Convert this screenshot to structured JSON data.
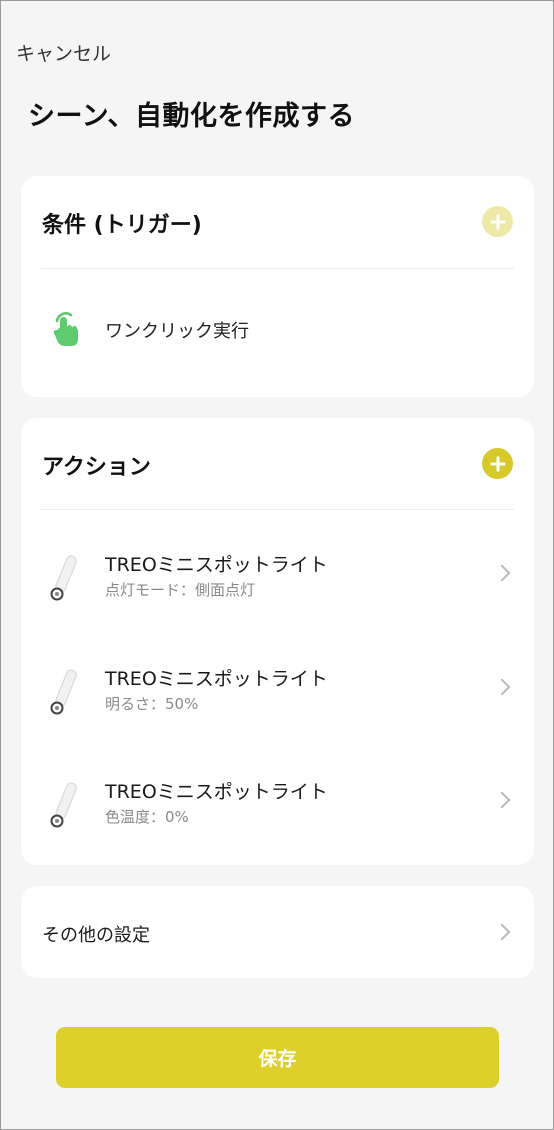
{
  "header": {
    "cancel_label": "キャンセル",
    "title": "シーン、自動化を作成する"
  },
  "condition": {
    "title": "条件 (トリガー)",
    "add_icon": "plus-icon",
    "add_color": "#efe9a8",
    "items": [
      {
        "icon": "tap-hand-icon",
        "label": "ワンクリック実行",
        "icon_color": "#5ecb6e"
      }
    ]
  },
  "action": {
    "title": "アクション",
    "add_icon": "plus-icon",
    "add_color": "#d7c92a",
    "items": [
      {
        "icon": "spotlight-icon",
        "name": "TREOミニスポットライト",
        "detail": "点灯モード：側面点灯"
      },
      {
        "icon": "spotlight-icon",
        "name": "TREOミニスポットライト",
        "detail": "明るさ：50%"
      },
      {
        "icon": "spotlight-icon",
        "name": "TREOミニスポットライト",
        "detail": "色温度：0%"
      }
    ]
  },
  "other_settings": {
    "label": "その他の設定"
  },
  "footer": {
    "save_label": "保存",
    "save_color": "#ded02b"
  }
}
